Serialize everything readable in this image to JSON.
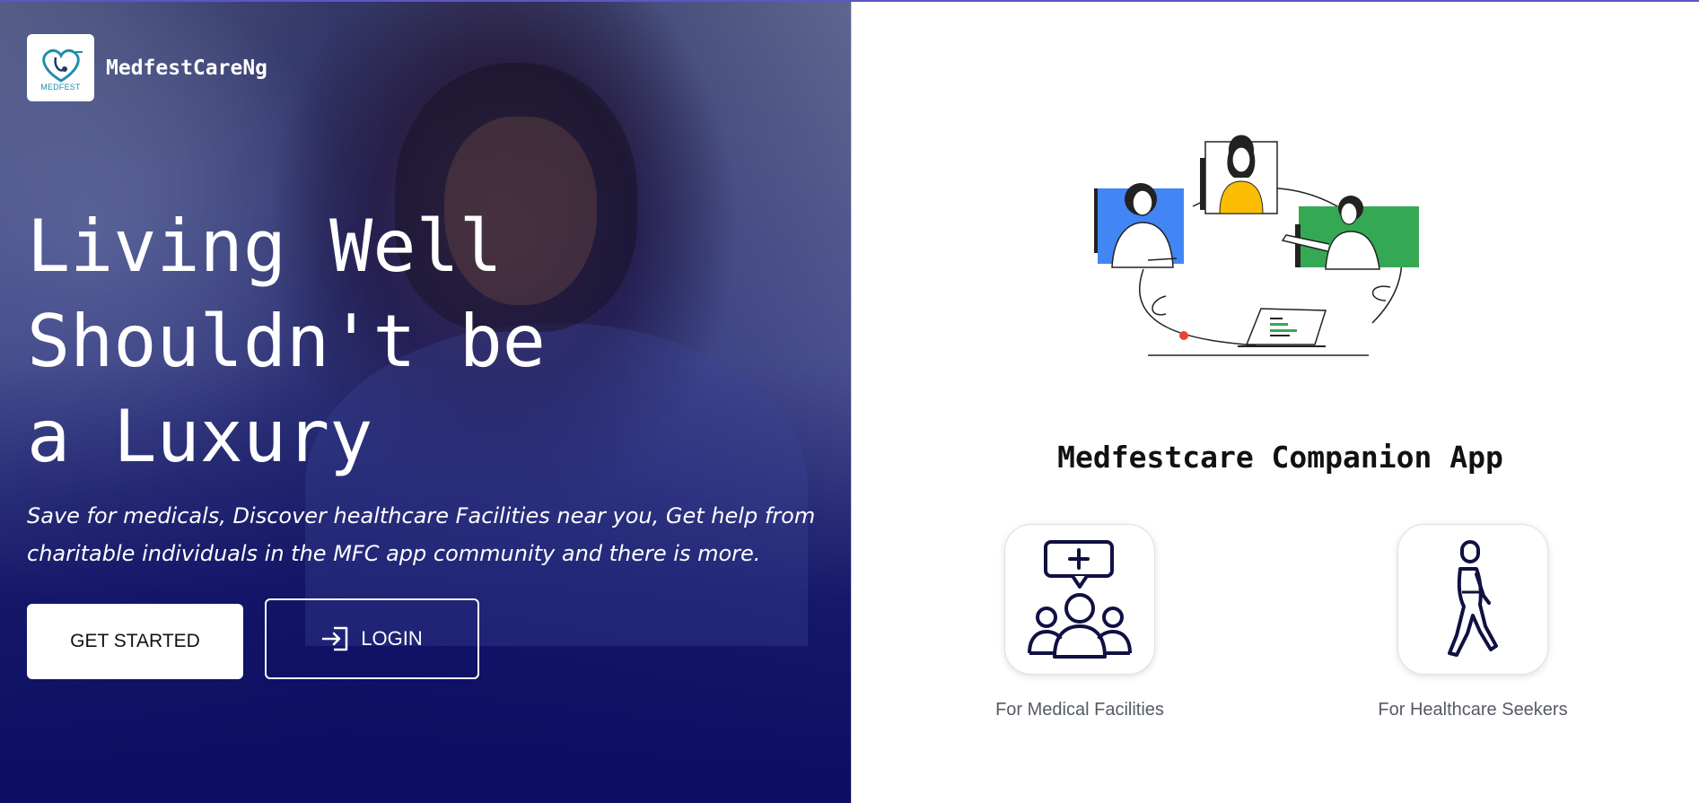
{
  "brand": {
    "name": "MedfestCareNg",
    "logo_text": "MEDFEST",
    "logo_icon": "heart-stethoscope-logo"
  },
  "hero": {
    "headline_lines": [
      "Living Well",
      "Shouldn't be",
      "a Luxury"
    ],
    "subtext_lines": [
      "Save for medicals, Discover healthcare Facilities near you, Get help from",
      "charitable individuals in the MFC app community and there is more."
    ],
    "get_started_label": "GET STARTED",
    "login_label": "LOGIN",
    "login_icon": "login-arrow-icon",
    "overlay_color": "#0c0d63"
  },
  "panel": {
    "title": "Medfestcare Companion App",
    "illustration": "telemedicine-video-call-illustration",
    "options": [
      {
        "label": "For Medical Facilities",
        "icon": "medical-community-icon"
      },
      {
        "label": "For Healthcare Seekers",
        "icon": "walking-person-icon"
      }
    ],
    "accent_colors": {
      "blue": "#4285f4",
      "green": "#34a853",
      "yellow": "#fbbc04",
      "red": "#ea4335",
      "navy": "#0c0d4f"
    }
  }
}
